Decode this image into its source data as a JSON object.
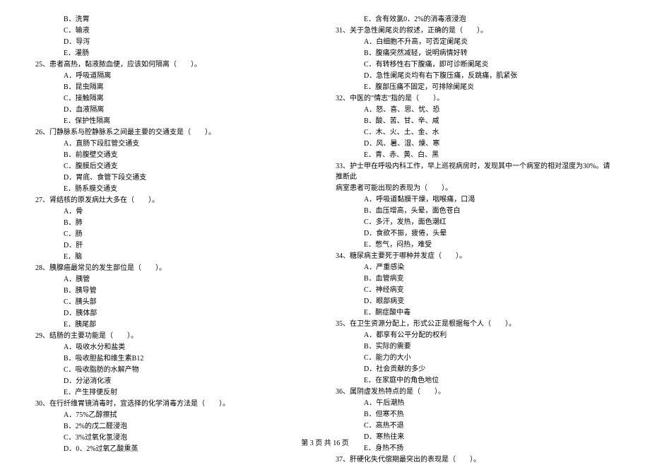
{
  "left_column": [
    {
      "type": "option",
      "text": "B．洗胃"
    },
    {
      "type": "option",
      "text": "C．输液"
    },
    {
      "type": "option",
      "text": "D．导泻"
    },
    {
      "type": "option",
      "text": "E．灌肠"
    },
    {
      "type": "question",
      "text": "25、患者高热，黏液脓血便，应该如何隔离（　　）。"
    },
    {
      "type": "option",
      "text": "A．呼吸道隔离"
    },
    {
      "type": "option",
      "text": "B．昆虫隔离"
    },
    {
      "type": "option",
      "text": "C．接触隔离"
    },
    {
      "type": "option",
      "text": "D．血液隔离"
    },
    {
      "type": "option",
      "text": "E．保护性隔离"
    },
    {
      "type": "question",
      "text": "26、门静脉系与腔静脉系之间最主要的交通支是（　　）。"
    },
    {
      "type": "option",
      "text": "A．直肠下段肛管交通支"
    },
    {
      "type": "option",
      "text": "B．前腹壁交通支"
    },
    {
      "type": "option",
      "text": "C．腹膜后交通支"
    },
    {
      "type": "option",
      "text": "D．胃底、食管下段交通支"
    },
    {
      "type": "option",
      "text": "E．肠系膜交通支"
    },
    {
      "type": "question",
      "text": "27、肾结核的原发病灶大多在（　　）。"
    },
    {
      "type": "option",
      "text": "A．骨"
    },
    {
      "type": "option",
      "text": "B．肺"
    },
    {
      "type": "option",
      "text": "C．肠"
    },
    {
      "type": "option",
      "text": "D．肝"
    },
    {
      "type": "option",
      "text": "E．脑"
    },
    {
      "type": "question",
      "text": "28、胰腺癌最常见的发生部位是（　　）。"
    },
    {
      "type": "option",
      "text": "A．胰管"
    },
    {
      "type": "option",
      "text": "B．胰导管"
    },
    {
      "type": "option",
      "text": "C．胰头部"
    },
    {
      "type": "option",
      "text": "D．胰体部"
    },
    {
      "type": "option",
      "text": "E．胰尾部"
    },
    {
      "type": "question",
      "text": "29、结肠的主要功能是（　　）。"
    },
    {
      "type": "option",
      "text": "A．吸收水分和盐类"
    },
    {
      "type": "option",
      "text": "B．吸收胆盐和维生素B12"
    },
    {
      "type": "option",
      "text": "C．吸收脂肪的水解产物"
    },
    {
      "type": "option",
      "text": "D．分泌消化液"
    },
    {
      "type": "option",
      "text": "E．产生排便反射"
    },
    {
      "type": "question",
      "text": "30、在行纤维胃镜消毒时，宜选择的化学消毒方法是（　　）。"
    },
    {
      "type": "option",
      "text": "A．75%乙醇擦拭"
    },
    {
      "type": "option",
      "text": "B．2%的戊二醛浸泡"
    },
    {
      "type": "option",
      "text": "C．3%过氧化氢浸泡"
    },
    {
      "type": "option",
      "text": "D．0．2%过氧乙酸熏蒸"
    }
  ],
  "right_column": [
    {
      "type": "option",
      "text": "E．含有效氯0．2%的消毒液浸泡"
    },
    {
      "type": "question",
      "text": "31、关于急性阑尾炎的叙述，正确的是（　　）。"
    },
    {
      "type": "option",
      "text": "A．白细胞不升高，可否定阑尾炎"
    },
    {
      "type": "option",
      "text": "B．腹痛突然减轻，说明病情好转"
    },
    {
      "type": "option",
      "text": "C．有转移性右下腹痛，即可诊断阑尾炎"
    },
    {
      "type": "option",
      "text": "D．急性阑尾炎均有右下腹压痛，反跳痛，肌紧张"
    },
    {
      "type": "option",
      "text": "E．腹部压痛不固定，可排除阑尾炎"
    },
    {
      "type": "question",
      "text": "32、中医的\"情志\"指的是（　　）。"
    },
    {
      "type": "option",
      "text": "A．怒、喜、思、忧、恐"
    },
    {
      "type": "option",
      "text": "B．酸、苦、甘、辛、咸"
    },
    {
      "type": "option",
      "text": "C．木、火、土、金、水"
    },
    {
      "type": "option",
      "text": "D．风、暑、湿、燥、寒"
    },
    {
      "type": "option",
      "text": "E．青、赤、黄、白、黑"
    },
    {
      "type": "question",
      "text": "33、护士甲在呼吸内科工作，早上巡视病房时，发现其中一个病室的相对湿度为30%。请推断此"
    },
    {
      "type": "question-cont",
      "text": "病室患者可能出现的表现为（　　）。"
    },
    {
      "type": "option",
      "text": "A．呼吸道黏膜干燥，咽喉痛，口渴"
    },
    {
      "type": "option",
      "text": "B．血压增高，头晕，面色苍白"
    },
    {
      "type": "option",
      "text": "C．多汗，发热，面色潮红"
    },
    {
      "type": "option",
      "text": "D．食欲不振，疲倦，头晕"
    },
    {
      "type": "option",
      "text": "E．憋气，闷热，难受"
    },
    {
      "type": "question",
      "text": "34、糖尿病主要死于哪种并发症（　　）。"
    },
    {
      "type": "option",
      "text": "A．严重感染"
    },
    {
      "type": "option",
      "text": "B．血管病变"
    },
    {
      "type": "option",
      "text": "C．神经病变"
    },
    {
      "type": "option",
      "text": "D．眼部病变"
    },
    {
      "type": "option",
      "text": "E．酮症酸中毒"
    },
    {
      "type": "question",
      "text": "35、在卫生资源分配上，形式公正是根据每个人（　　）。"
    },
    {
      "type": "option",
      "text": "A．都享有公平分配的权利"
    },
    {
      "type": "option",
      "text": "B．实际的需要"
    },
    {
      "type": "option",
      "text": "C．能力的大小"
    },
    {
      "type": "option",
      "text": "D．社会贡献的多少"
    },
    {
      "type": "option",
      "text": "E．在家庭中的角色地位"
    },
    {
      "type": "question",
      "text": "36、属阴虚发热特点的是（　　）。"
    },
    {
      "type": "option",
      "text": "A．午后潮热"
    },
    {
      "type": "option",
      "text": "B．但寒不热"
    },
    {
      "type": "option",
      "text": "C．高热不退"
    },
    {
      "type": "option",
      "text": "D．寒热往来"
    },
    {
      "type": "option",
      "text": "E．身热不扬"
    },
    {
      "type": "question",
      "text": "37、肝硬化失代偿期最突出的表现是（　　）。"
    }
  ],
  "footer": "第 3 页 共 16 页"
}
